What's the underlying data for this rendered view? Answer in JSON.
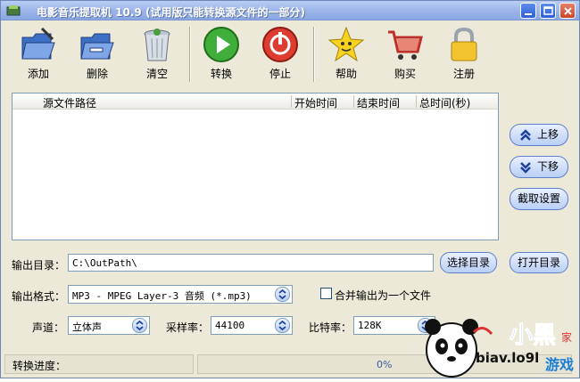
{
  "window": {
    "title": "电影音乐提取机 10.9 (试用版只能转换源文件的一部分)"
  },
  "toolbar": {
    "add": "添加",
    "delete": "删除",
    "clear": "清空",
    "convert": "转换",
    "stop": "停止",
    "help": "帮助",
    "buy": "购买",
    "register": "注册"
  },
  "list": {
    "columns": [
      "源文件路径",
      "开始时间",
      "结束时间",
      "总时间(秒)"
    ]
  },
  "side_buttons": {
    "up": "上移",
    "down": "下移",
    "trim": "截取设置"
  },
  "output": {
    "dir_label": "输出目录：",
    "dir_value": "C:\\OutPath\\",
    "choose_dir": "选择目录",
    "open_dir": "打开目录",
    "format_label": "输出格式：",
    "format_value": "MP3 - MPEG Layer-3 音频 (*.mp3)",
    "merge_label": "合并输出为一个文件",
    "channel_label": "声道：",
    "channel_value": "立体声",
    "samplerate_label": "采样率：",
    "samplerate_value": "44100",
    "bitrate_label": "比特率：",
    "bitrate_value": "128K"
  },
  "status": {
    "progress_label": "转换进度：",
    "progress_value": "0%"
  },
  "watermark": {
    "text": "biav.lo9l"
  }
}
